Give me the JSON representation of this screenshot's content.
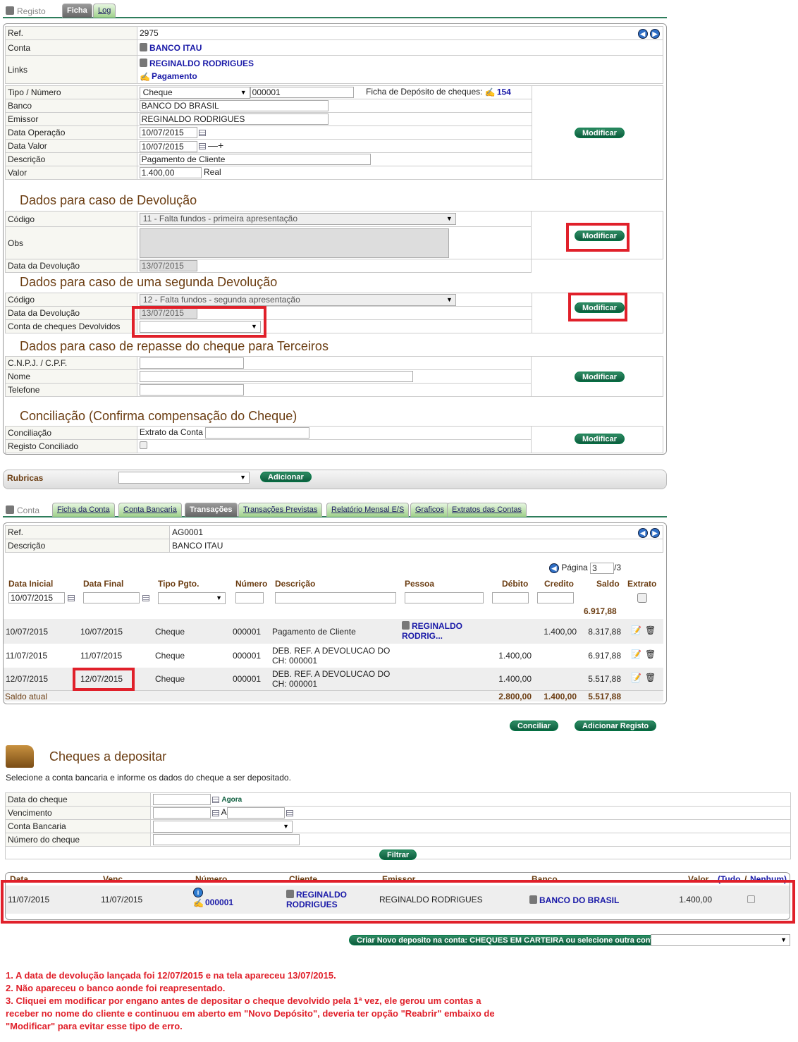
{
  "registo": {
    "tabs": {
      "title": "Registo",
      "ficha": "Ficha",
      "log": "Log"
    },
    "ref_label": "Ref.",
    "ref": "2975",
    "conta_label": "Conta",
    "conta": "BANCO ITAU",
    "links_label": "Links",
    "link1": "REGINALDO RODRIGUES",
    "link2": "Pagamento",
    "tipo_label": "Tipo / Número",
    "tipo": "Cheque",
    "numero": "000001",
    "ficha_dep_label": "Ficha de Depósito de cheques:",
    "ficha_dep": "154",
    "banco_label": "Banco",
    "banco": "BANCO DO BRASIL",
    "emissor_label": "Emissor",
    "emissor": "REGINALDO RODRIGUES",
    "data_op_label": "Data Operação",
    "data_op": "10/07/2015",
    "data_valor_label": "Data Valor",
    "data_valor": "10/07/2015",
    "descricao_label": "Descrição",
    "descricao": "Pagamento de Cliente",
    "valor_label": "Valor",
    "valor": "1.400,00",
    "moeda": "Real",
    "modificar": "Modificar"
  },
  "devolucao": {
    "title": "Dados para caso de Devolução",
    "codigo_label": "Código",
    "codigo": "11 - Falta fundos - primeira apresentação",
    "obs_label": "Obs",
    "data_label": "Data da Devolução",
    "data": "13/07/2015"
  },
  "devolucao2": {
    "title": "Dados para caso de uma segunda Devolução",
    "codigo_label": "Código",
    "codigo": "12 - Falta fundos - segunda apresentação",
    "data_label": "Data da Devolução",
    "data": "13/07/2015",
    "conta_label": "Conta de cheques Devolvidos"
  },
  "repasse": {
    "title": "Dados para caso de repasse do cheque para Terceiros",
    "cnpj_label": "C.N.P.J. / C.P.F.",
    "nome_label": "Nome",
    "telefone_label": "Telefone"
  },
  "conciliacao": {
    "title": "Conciliação (Confirma compensação do Cheque)",
    "conc_label": "Conciliação",
    "extrato_label": "Extrato da Conta",
    "registo_label": "Registo Conciliado"
  },
  "rubricas": {
    "label": "Rubricas",
    "adicionar": "Adicionar"
  },
  "conta": {
    "tabs": {
      "title": "Conta",
      "t1": "Ficha da Conta",
      "t2": "Conta Bancaria",
      "t3": "Transações",
      "t4": "Transações Previstas",
      "t5": "Relatório Mensal E/S",
      "t6": "Graficos",
      "t7": "Extratos das Contas"
    },
    "ref_label": "Ref.",
    "ref": "AG0001",
    "desc_label": "Descrição",
    "desc": "BANCO ITAU",
    "pagina_label": "Página",
    "pagina": "3",
    "total_paginas": "/3",
    "cols": [
      "Data Inicial",
      "Data Final",
      "Tipo Pgto.",
      "Número",
      "Descrição",
      "Pessoa",
      "Débito",
      "Credito",
      "Saldo",
      "Extrato"
    ],
    "data_inicial": "10/07/2015",
    "saldo_inicial": "6.917,88",
    "rows": [
      {
        "d1": "10/07/2015",
        "d2": "10/07/2015",
        "tipo": "Cheque",
        "num": "000001",
        "desc1": "Pagamento de Cliente",
        "desc2": "",
        "pessoa1": "REGINALDO",
        "pessoa2": "RODRIG...",
        "deb": "",
        "cred": "1.400,00",
        "saldo": "8.317,88"
      },
      {
        "d1": "11/07/2015",
        "d2": "11/07/2015",
        "tipo": "Cheque",
        "num": "000001",
        "desc1": "DEB. REF. A DEVOLUCAO DO",
        "desc2": "CH: 000001",
        "pessoa1": "",
        "pessoa2": "",
        "deb": "1.400,00",
        "cred": "",
        "saldo": "6.917,88"
      },
      {
        "d1": "12/07/2015",
        "d2": "12/07/2015",
        "tipo": "Cheque",
        "num": "000001",
        "desc1": "DEB. REF. A DEVOLUCAO DO",
        "desc2": "CH: 000001",
        "pessoa1": "",
        "pessoa2": "",
        "deb": "1.400,00",
        "cred": "",
        "saldo": "5.517,88"
      }
    ],
    "saldo_atual_label": "Saldo atual",
    "tot_deb": "2.800,00",
    "tot_cred": "1.400,00",
    "tot_saldo": "5.517,88",
    "conciliar": "Conciliar",
    "adicionar_registo": "Adicionar Registo"
  },
  "cheques": {
    "title": "Cheques a depositar",
    "subtitle": "Selecione a conta bancaria e informe os dados do cheque a ser depositado.",
    "data_label": "Data do cheque",
    "agora": "Agora",
    "venc_label": "Vencimento",
    "a": "A",
    "conta_label": "Conta Bancaria",
    "num_label": "Número do cheque",
    "filtrar": "Filtrar",
    "cols": [
      "Data",
      "Venc.",
      "Número",
      "Cliente",
      "Emissor",
      "Banco",
      "Valor"
    ],
    "tudo": "(Tudo",
    "sep": "/",
    "nenhum": "Nenhum)",
    "row": {
      "data": "11/07/2015",
      "venc": "11/07/2015",
      "numero": "000001",
      "cliente1": "REGINALDO",
      "cliente2": "RODRIGUES",
      "emissor": "REGINALDO RODRIGUES",
      "banco": "BANCO DO BRASIL",
      "valor": "1.400,00"
    },
    "criar": "Criar Novo deposito na conta: CHEQUES EM CARTEIRA ou selecione outra conta"
  },
  "notes": [
    "1. A data de devolução lançada foi 12/07/2015 e na tela apareceu 13/07/2015.",
    "2. Não apareceu o banco aonde foi reapresentado.",
    "3. Cliquei em modificar por engano antes de depositar o cheque devolvido pela 1ª vez, ele gerou um contas a",
    "receber no nome do cliente e continuou em aberto em \"Novo Depósito\", deveria ter opção \"Reabrir\" embaixo de",
    "\"Modificar\" para evitar esse tipo de erro."
  ],
  "colors": {
    "accent": "#0b5c3c",
    "heading": "#6b3d12",
    "highlight": "#e0202a"
  }
}
